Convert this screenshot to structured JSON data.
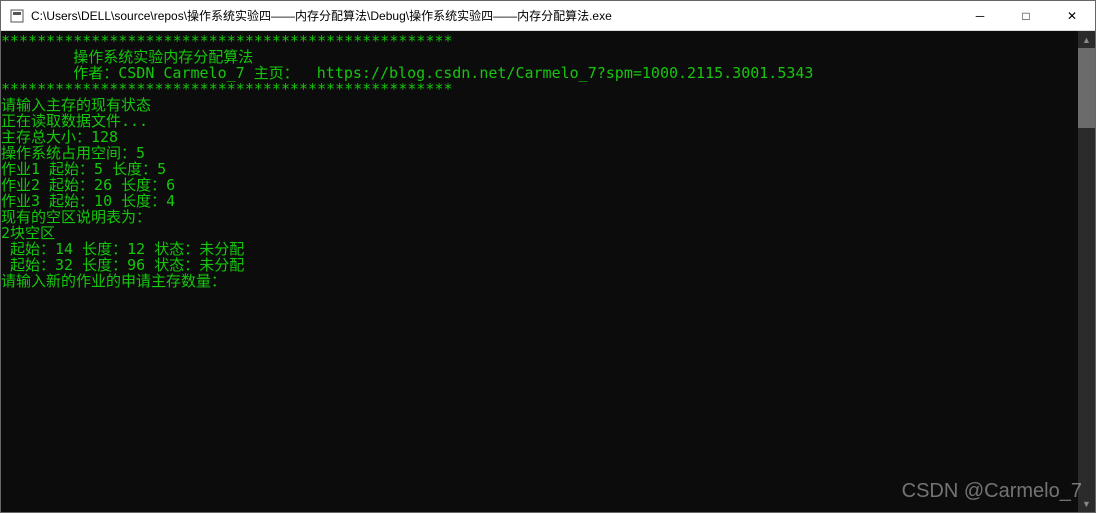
{
  "titlebar": {
    "path": "C:\\Users\\DELL\\source\\repos\\操作系统实验四——内存分配算法\\Debug\\操作系统实验四——内存分配算法.exe"
  },
  "winbuttons": {
    "min": "─",
    "max": "□",
    "close": "✕"
  },
  "console": {
    "lines": [
      "**************************************************",
      "        操作系统实验内存分配算法",
      "        作者：CSDN Carmelo_7 主页：  https://blog.csdn.net/Carmelo_7?spm=1000.2115.3001.5343",
      "**************************************************",
      "请输入主存的现有状态",
      "正在读取数据文件...",
      "主存总大小：128",
      "操作系统占用空间：5",
      "作业1 起始：5 长度：5",
      "作业2 起始：26 长度：6",
      "作业3 起始：10 长度：4",
      "现有的空区说明表为：",
      "2块空区",
      " 起始：14 长度：12 状态：未分配",
      " 起始：32 长度：96 状态：未分配",
      "请输入新的作业的申请主存数量："
    ]
  },
  "watermark": "CSDN @Carmelo_7"
}
